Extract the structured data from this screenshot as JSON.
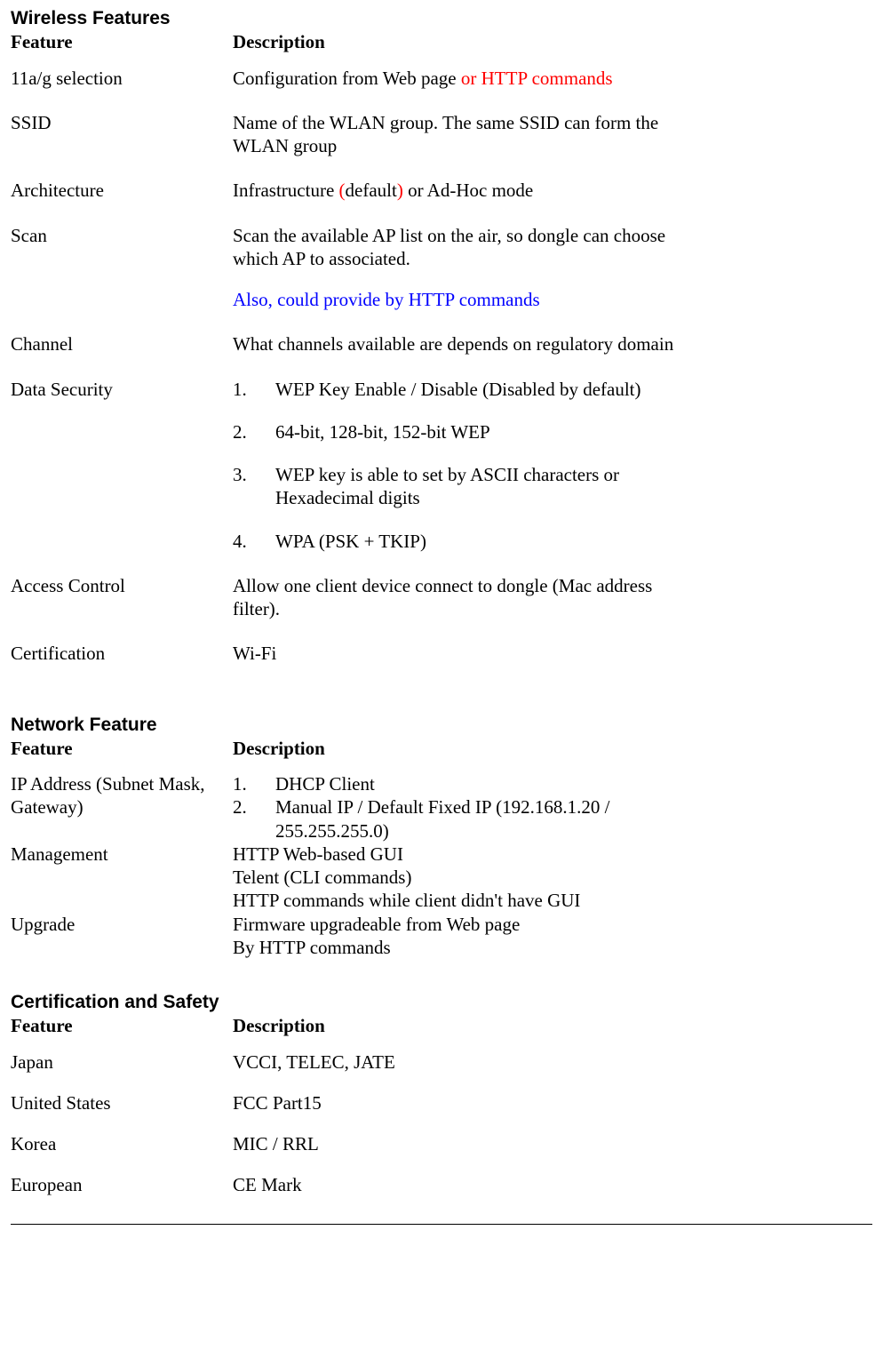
{
  "sections": {
    "wireless": {
      "title": "Wireless Features",
      "col1": "Feature",
      "col2": "Description",
      "rows": {
        "sel": {
          "f": "11a/g selection",
          "d1": "Configuration from Web page ",
          "d2": "or HTTP commands"
        },
        "ssid": {
          "f": "SSID",
          "d": "Name of the WLAN group. The same SSID can form the WLAN group"
        },
        "arch": {
          "f": "Architecture",
          "d1": "Infrastructure ",
          "p1": "(",
          "d2": "default",
          "p2": ")",
          "d3": " or Ad-Hoc mode"
        },
        "scan": {
          "f": "Scan",
          "d1": "Scan the available AP list on the air, so dongle can choose which AP to associated.",
          "d2": "Also, could provide by HTTP commands"
        },
        "channel": {
          "f": "Channel",
          "d": "What channels available are depends on regulatory domain"
        },
        "security": {
          "f": "Data Security",
          "items": [
            "WEP Key Enable / Disable (Disabled by default)",
            "64-bit, 128-bit, 152-bit WEP",
            "WEP key is able to set by ASCII characters or Hexadecimal digits",
            "WPA (PSK + TKIP)"
          ]
        },
        "access": {
          "f": "Access Control",
          "d": "Allow one client device connect to dongle (Mac address filter)."
        },
        "cert": {
          "f": "Certification",
          "d": "Wi-Fi"
        }
      }
    },
    "network": {
      "title": "Network Feature",
      "col1": "Feature",
      "col2": "Description",
      "rows": {
        "ip": {
          "f": "IP Address (Subnet Mask, Gateway)",
          "items": [
            "DHCP Client",
            "Manual IP / Default Fixed IP (192.168.1.20 / 255.255.255.0)"
          ]
        },
        "mgmt": {
          "f": "Management",
          "l1": "HTTP Web-based GUI",
          "l2": "Telent (CLI commands)",
          "l3": "HTTP commands while client didn't have GUI"
        },
        "upgrade": {
          "f": "Upgrade",
          "l1": "Firmware upgradeable from Web page",
          "l2": "By HTTP commands"
        }
      }
    },
    "certsafety": {
      "title": "Certification and Safety",
      "col1": "Feature",
      "col2": "Description",
      "rows": {
        "japan": {
          "f": "Japan",
          "d": "VCCI, TELEC, JATE"
        },
        "us": {
          "f": "United States",
          "d": "FCC Part15"
        },
        "korea": {
          "f": "Korea",
          "d": "MIC / RRL"
        },
        "eu": {
          "f": "European",
          "d": "CE Mark"
        }
      }
    }
  }
}
